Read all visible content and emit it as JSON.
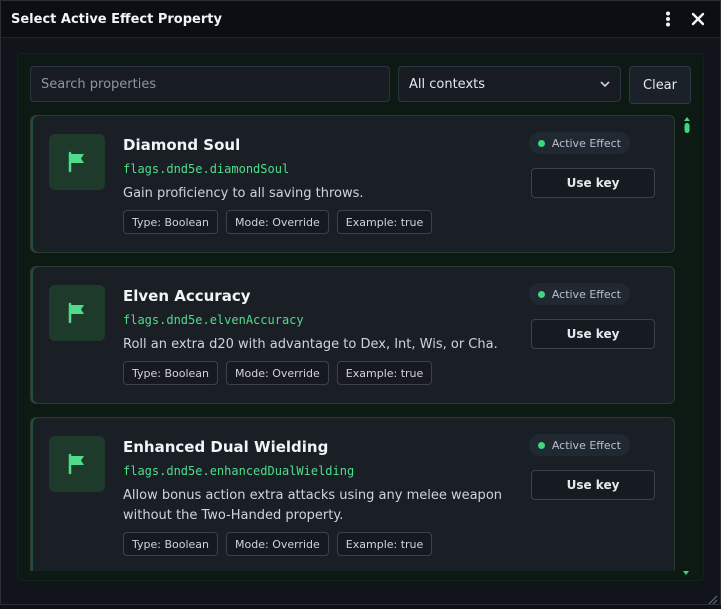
{
  "window": {
    "title": "Select Active Effect Property"
  },
  "toolbar": {
    "menu_icon": "more-vertical-icon",
    "close_icon": "close-icon"
  },
  "filters": {
    "search_placeholder": "Search properties",
    "search_value": "",
    "context_selected": "All contexts",
    "clear_label": "Clear"
  },
  "items": [
    {
      "title": "Diamond Soul",
      "key": "flags.dnd5e.diamondSoul",
      "description": "Gain proficiency to all saving throws.",
      "badge": "Active Effect",
      "use_label": "Use key",
      "chips": [
        "Type: Boolean",
        "Mode: Override",
        "Example: true"
      ]
    },
    {
      "title": "Elven Accuracy",
      "key": "flags.dnd5e.elvenAccuracy",
      "description": "Roll an extra d20 with advantage to Dex, Int, Wis, or Cha.",
      "badge": "Active Effect",
      "use_label": "Use key",
      "chips": [
        "Type: Boolean",
        "Mode: Override",
        "Example: true"
      ]
    },
    {
      "title": "Enhanced Dual Wielding",
      "key": "flags.dnd5e.enhancedDualWielding",
      "description": "Allow bonus action extra attacks using any melee weapon without the Two-Handed property.",
      "badge": "Active Effect",
      "use_label": "Use key",
      "chips": [
        "Type: Boolean",
        "Mode: Override",
        "Example: true"
      ]
    }
  ],
  "colors": {
    "accent": "#3fd67f",
    "key_text": "#4fdc8a",
    "card_bg": "#1a1f26",
    "panel_bg": "#0d1a14"
  }
}
